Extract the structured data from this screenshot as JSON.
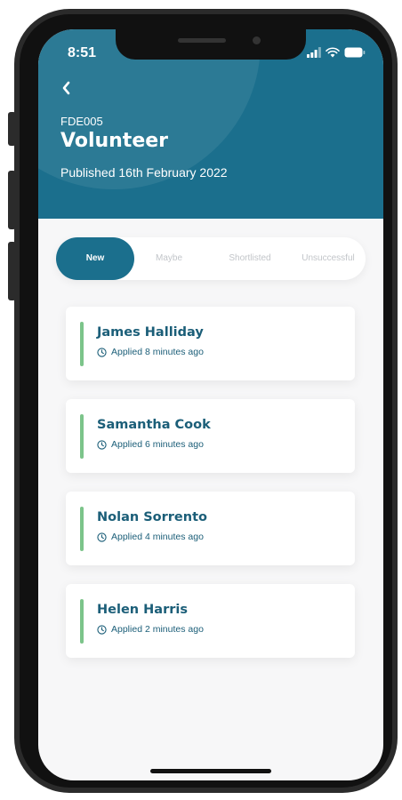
{
  "status_bar": {
    "time": "8:51",
    "icons": [
      "signal-icon",
      "wifi-icon",
      "battery-icon"
    ]
  },
  "header": {
    "back_icon": "chevron-left-icon",
    "code": "FDE005",
    "title": "Volunteer",
    "published": "Published 16th February 2022",
    "color": "#1b6f8d"
  },
  "tabs": [
    {
      "label": "New",
      "active": true
    },
    {
      "label": "Maybe",
      "active": false
    },
    {
      "label": "Shortlisted",
      "active": false
    },
    {
      "label": "Unsuccessful",
      "active": false
    }
  ],
  "applicants": [
    {
      "name": "James Halliday",
      "applied": "Applied 8 minutes ago"
    },
    {
      "name": "Samantha Cook",
      "applied": "Applied 6 minutes ago"
    },
    {
      "name": "Nolan Sorrento",
      "applied": "Applied 4 minutes ago"
    },
    {
      "name": "Helen Harris",
      "applied": "Applied 2 minutes ago"
    }
  ],
  "colors": {
    "accent": "#1b6f8d",
    "name_text": "#1b5e78",
    "status_bar_green": "#7cc48a",
    "inactive_tab": "#c2c5c9"
  }
}
